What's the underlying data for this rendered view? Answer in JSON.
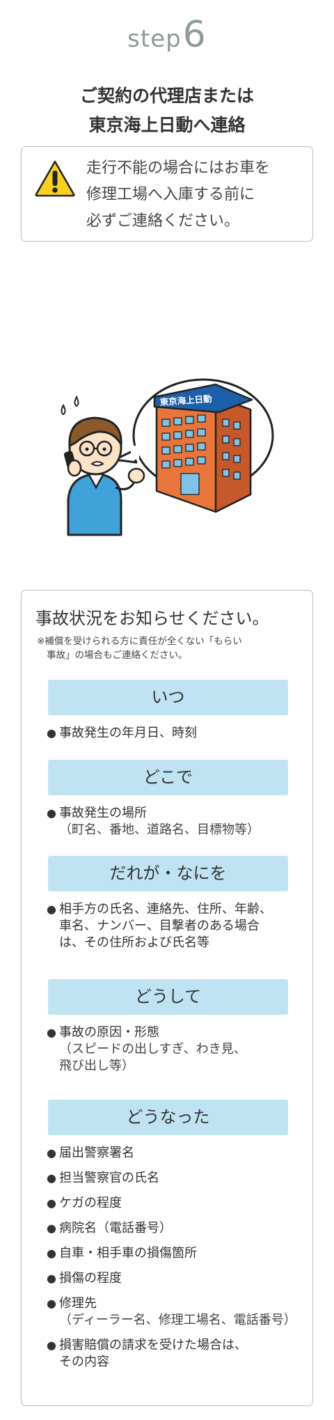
{
  "header": {
    "step_word": "step",
    "step_number": "6"
  },
  "title": {
    "line1": "ご契約の代理店または",
    "line2": "東京海上日動へ連絡"
  },
  "warning": {
    "icon": "warning-icon",
    "line1": "走行不能の場合にはお車を",
    "line2": "修理工場へ入庫する前に",
    "line3": "必ずご連絡ください。"
  },
  "illustration": {
    "building_sign": "東京海上日動"
  },
  "info": {
    "title": "事故状況をお知らせください。",
    "note_line1": "※補償を受けられる方に責任が全くない「もらい",
    "note_line2": "事故」の場合もご連絡ください。",
    "sections": [
      {
        "heading": "いつ",
        "items": [
          {
            "lines": [
              "事故発生の年月日、時刻"
            ]
          }
        ]
      },
      {
        "heading": "どこで",
        "items": [
          {
            "lines": [
              "事故発生の場所",
              "（町名、番地、道路名、目標物等）"
            ]
          }
        ]
      },
      {
        "heading": "だれが・なにを",
        "items": [
          {
            "lines": [
              "相手方の氏名、連絡先、住所、年齢、",
              "車名、ナンバー、目撃者のある場合",
              "は、その住所および氏名等"
            ]
          }
        ]
      },
      {
        "heading": "どうして",
        "items": [
          {
            "lines": [
              "事故の原因・形態",
              "（スピードの出しすぎ、わき見、",
              "飛び出し等）"
            ]
          }
        ]
      },
      {
        "heading": "どうなった",
        "items": [
          {
            "lines": [
              "届出警察署名"
            ]
          },
          {
            "lines": [
              "担当警察官の氏名"
            ]
          },
          {
            "lines": [
              "ケガの程度"
            ]
          },
          {
            "lines": [
              "病院名（電話番号）"
            ]
          },
          {
            "lines": [
              "自車・相手車の損傷箇所"
            ]
          },
          {
            "lines": [
              "損傷の程度"
            ]
          },
          {
            "lines": [
              "修理先",
              "（ディーラー名、修理工場名、電話番号）"
            ]
          },
          {
            "lines": [
              "損害賠償の請求を受けた場合は、",
              "その内容"
            ]
          }
        ]
      }
    ]
  }
}
